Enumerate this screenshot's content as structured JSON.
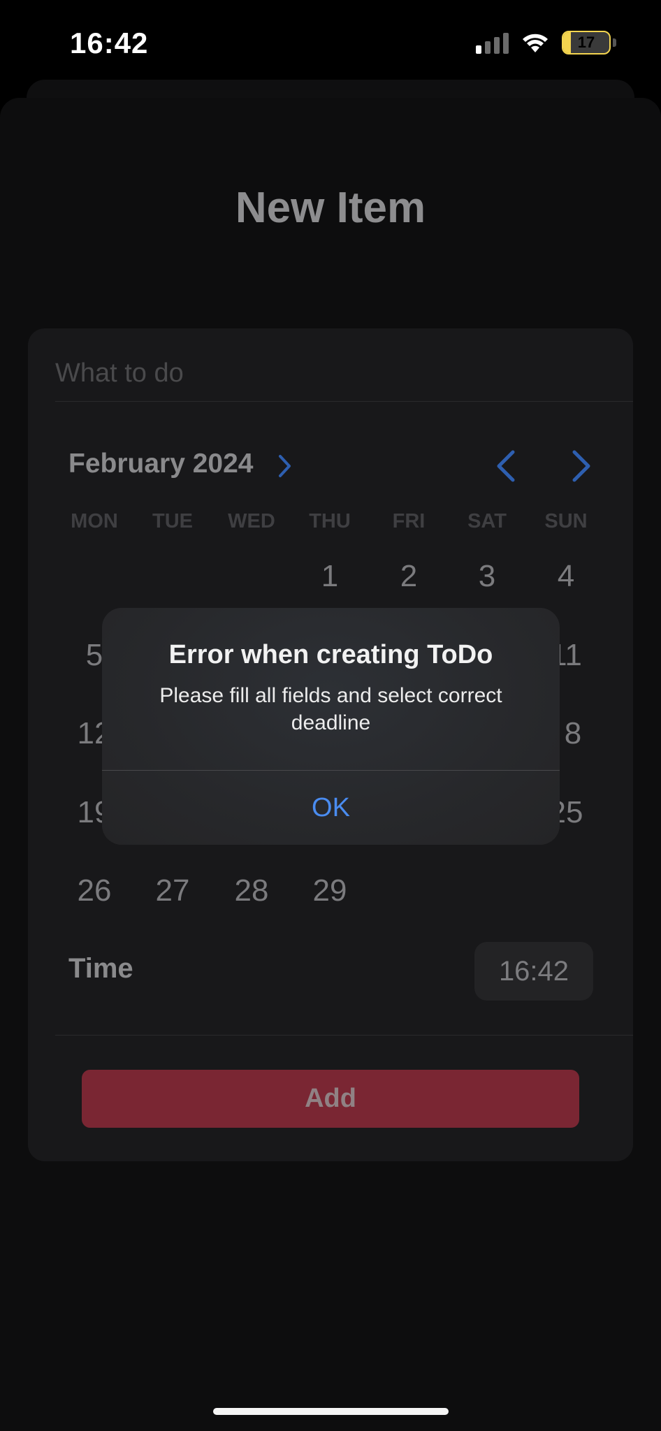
{
  "status_bar": {
    "time": "16:42",
    "battery": "17",
    "battery_level": 0.17,
    "signal_bars_active": 1,
    "icons": [
      "cellular-signal-icon",
      "wifi-icon",
      "battery-charging-icon"
    ]
  },
  "screen": {
    "title": "New Item"
  },
  "form": {
    "todo_placeholder": "What to do",
    "calendar": {
      "month_label": "February 2024",
      "weekdays": [
        "MON",
        "TUE",
        "WED",
        "THU",
        "FRI",
        "SAT",
        "SUN"
      ],
      "days": [
        "1",
        "2",
        "3",
        "4",
        "5",
        "11",
        "12",
        "8",
        "19",
        "25",
        "26",
        "27",
        "28",
        "29"
      ]
    },
    "time_label": "Time",
    "time_value": "16:42",
    "add_label": "Add"
  },
  "alert": {
    "title": "Error when creating ToDo",
    "message": "Please fill all fields and select correct deadline",
    "ok_label": "OK"
  },
  "colors": {
    "accent_blue": "#4a8cf0",
    "add_button": "#7a2633",
    "background": "#000000"
  }
}
